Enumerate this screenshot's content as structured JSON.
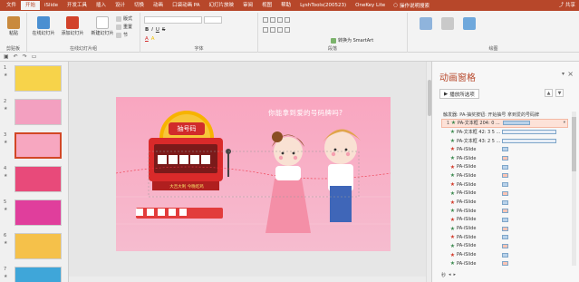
{
  "ribbon_tabs": [
    "文件",
    "开始",
    "iSlide",
    "开发工具",
    "插入",
    "设计",
    "切换",
    "动画",
    "口袋动画 PA",
    "幻灯片放映",
    "审阅",
    "视图",
    "帮助",
    "LyshTools(200523)",
    "OneKey Lite"
  ],
  "active_tab_index": 1,
  "tell_me": "操作说明搜索",
  "share_label": "共享",
  "ribbon": {
    "clipboard": {
      "paste": "粘贴",
      "label": "剪贴板"
    },
    "slides": {
      "new_slide": "新建幻灯片",
      "layout": "版式",
      "reset": "重置",
      "section": "节",
      "insert_online": "在线幻灯片",
      "add_slide": "添加幻灯片",
      "label": "在线幻灯片组"
    },
    "font_label": "字体",
    "paragraph": {
      "convert_smartart": "转换为 SmartArt",
      "label": "段落"
    },
    "drawing_label": "绘图"
  },
  "thumbnails": [
    {
      "num": "1"
    },
    {
      "num": "2"
    },
    {
      "num": "3"
    },
    {
      "num": "4"
    },
    {
      "num": "5"
    },
    {
      "num": "6"
    },
    {
      "num": "7"
    }
  ],
  "slide": {
    "title": "你能拿到爱的号码牌吗?",
    "sign_text": "抽号码",
    "screen_text": "大吉大利 今晚吃鸡"
  },
  "anim_pane": {
    "title": "动画窗格",
    "play_label": "播放所选项",
    "trigger": "触发器: PA-抽奖按钮: 开始抽号 拿到爱的号码牌",
    "items": [
      {
        "num": "1",
        "icon": "star-green",
        "name": "PA-文本框 204: 0 ...",
        "bar_color": "#b9d2ea",
        "bar_width": 30,
        "selected": true
      },
      {
        "num": "",
        "icon": "star-green",
        "name": "PA-文本框 42: 3 5 ...",
        "bar_color": "#e7eef7",
        "bar_width": 60
      },
      {
        "num": "",
        "icon": "star-green",
        "name": "PA-文本框 43: 2 5 ...",
        "bar_color": "#e7eef7",
        "bar_width": 60
      },
      {
        "num": "",
        "icon": "star-red",
        "name": "PA-iSlide",
        "bar_color": "#b9d2ea",
        "bar_width": 7
      },
      {
        "num": "",
        "icon": "star-green",
        "name": "PA-iSlide",
        "bar_color": "#fac5b5",
        "bar_width": 7
      },
      {
        "num": "",
        "icon": "star-red",
        "name": "PA-iSlide",
        "bar_color": "#b9d2ea",
        "bar_width": 7
      },
      {
        "num": "",
        "icon": "star-green",
        "name": "PA-iSlide",
        "bar_color": "#fac5b5",
        "bar_width": 7
      },
      {
        "num": "",
        "icon": "star-red",
        "name": "PA-iSlide",
        "bar_color": "#b9d2ea",
        "bar_width": 7
      },
      {
        "num": "",
        "icon": "star-green",
        "name": "PA-iSlide",
        "bar_color": "#fac5b5",
        "bar_width": 7
      },
      {
        "num": "",
        "icon": "star-red",
        "name": "PA-iSlide",
        "bar_color": "#b9d2ea",
        "bar_width": 7
      },
      {
        "num": "",
        "icon": "star-green",
        "name": "PA-iSlide",
        "bar_color": "#fac5b5",
        "bar_width": 7
      },
      {
        "num": "",
        "icon": "star-red",
        "name": "PA-iSlide",
        "bar_color": "#b9d2ea",
        "bar_width": 7
      },
      {
        "num": "",
        "icon": "star-green",
        "name": "PA-iSlide",
        "bar_color": "#fac5b5",
        "bar_width": 7
      },
      {
        "num": "",
        "icon": "star-red",
        "name": "PA-iSlide",
        "bar_color": "#b9d2ea",
        "bar_width": 7
      },
      {
        "num": "",
        "icon": "star-green",
        "name": "PA-iSlide",
        "bar_color": "#fac5b5",
        "bar_width": 7
      },
      {
        "num": "",
        "icon": "star-red",
        "name": "PA-iSlide",
        "bar_color": "#b9d2ea",
        "bar_width": 7
      },
      {
        "num": "",
        "icon": "star-green",
        "name": "PA-iSlide",
        "bar_color": "#fac5b5",
        "bar_width": 7
      }
    ],
    "footer_seconds": "秒"
  },
  "colors": {
    "accent": "#b7472a",
    "slide_bg": "#f7b7cc",
    "star_green": "#3c8a4f",
    "star_red": "#d23b2a"
  }
}
